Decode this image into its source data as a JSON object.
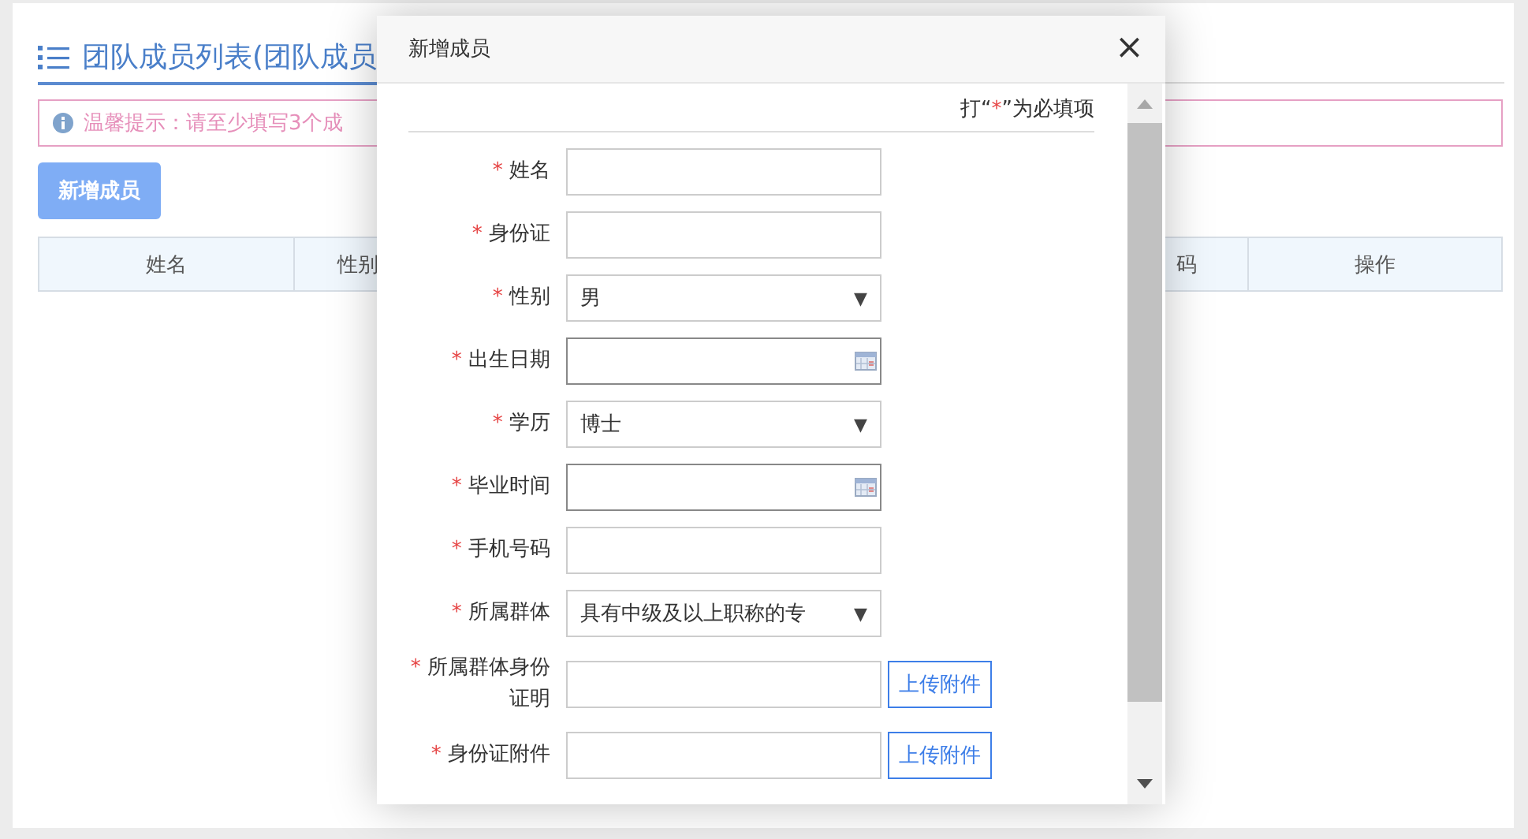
{
  "page": {
    "title": "团队成员列表(团队成员",
    "tip": "温馨提示：请至少填写3个成",
    "add_button": "新增成员",
    "table_columns": [
      {
        "label": "姓名",
        "kind": "full"
      },
      {
        "label": "性别",
        "kind": "left"
      },
      {
        "label": "码",
        "kind": "right"
      },
      {
        "label": "操作",
        "kind": "full"
      }
    ]
  },
  "dialog": {
    "title": "新增成员",
    "close": "×",
    "required_note": {
      "before": "打“",
      "mark": "*",
      "after": "”为必填项"
    },
    "fields": [
      {
        "label": "姓名",
        "required": true,
        "kind": "text"
      },
      {
        "label": "身份证",
        "required": true,
        "kind": "text"
      },
      {
        "label": "性别",
        "required": true,
        "kind": "select",
        "value": "男",
        "arrow": "▼"
      },
      {
        "label": "出生日期",
        "required": true,
        "kind": "date"
      },
      {
        "label": "学历",
        "required": true,
        "kind": "select",
        "value": "博士",
        "arrow": "▼"
      },
      {
        "label": "毕业时间",
        "required": true,
        "kind": "date"
      },
      {
        "label": "手机号码",
        "required": true,
        "kind": "text"
      },
      {
        "label": "所属群体",
        "required": true,
        "kind": "select",
        "value": "具有中级及以上职称的专",
        "arrow": "▼"
      },
      {
        "label": "所属群体身份证明",
        "required": true,
        "kind": "upload",
        "button": "上传附件"
      },
      {
        "label": "身份证附件",
        "required": true,
        "kind": "upload",
        "button": "上传附件"
      }
    ]
  }
}
